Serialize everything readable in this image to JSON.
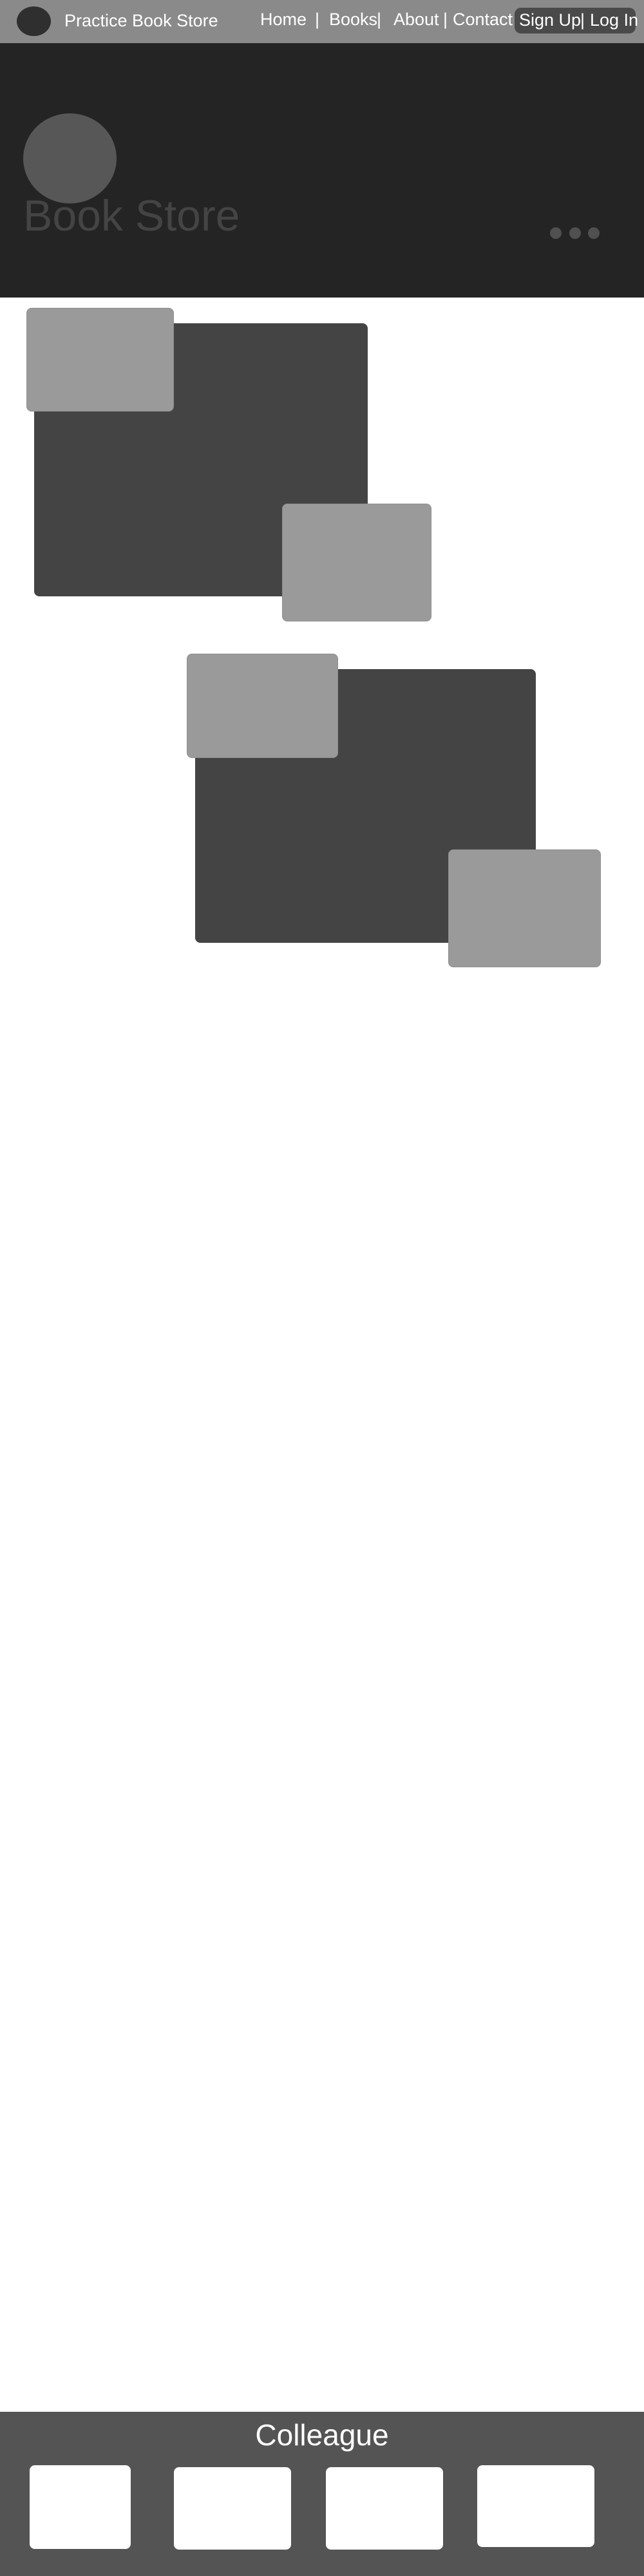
{
  "navbar": {
    "brand": "Practice Book Store",
    "items": [
      {
        "label": "Home"
      },
      {
        "label": "Books"
      },
      {
        "label": "About"
      },
      {
        "label": "Contact"
      }
    ],
    "separator": "|",
    "auth": {
      "signup": "Sign Up",
      "separator": "|",
      "login": "Log In"
    }
  },
  "hero": {
    "title": "Book Store",
    "slides": 3
  },
  "footer": {
    "title": "Colleague"
  },
  "colors": {
    "navbar": "#8a8a8a",
    "hero": "#242424",
    "card_dark": "#444444",
    "card_light": "#9a9a9a",
    "footer": "#545454"
  }
}
